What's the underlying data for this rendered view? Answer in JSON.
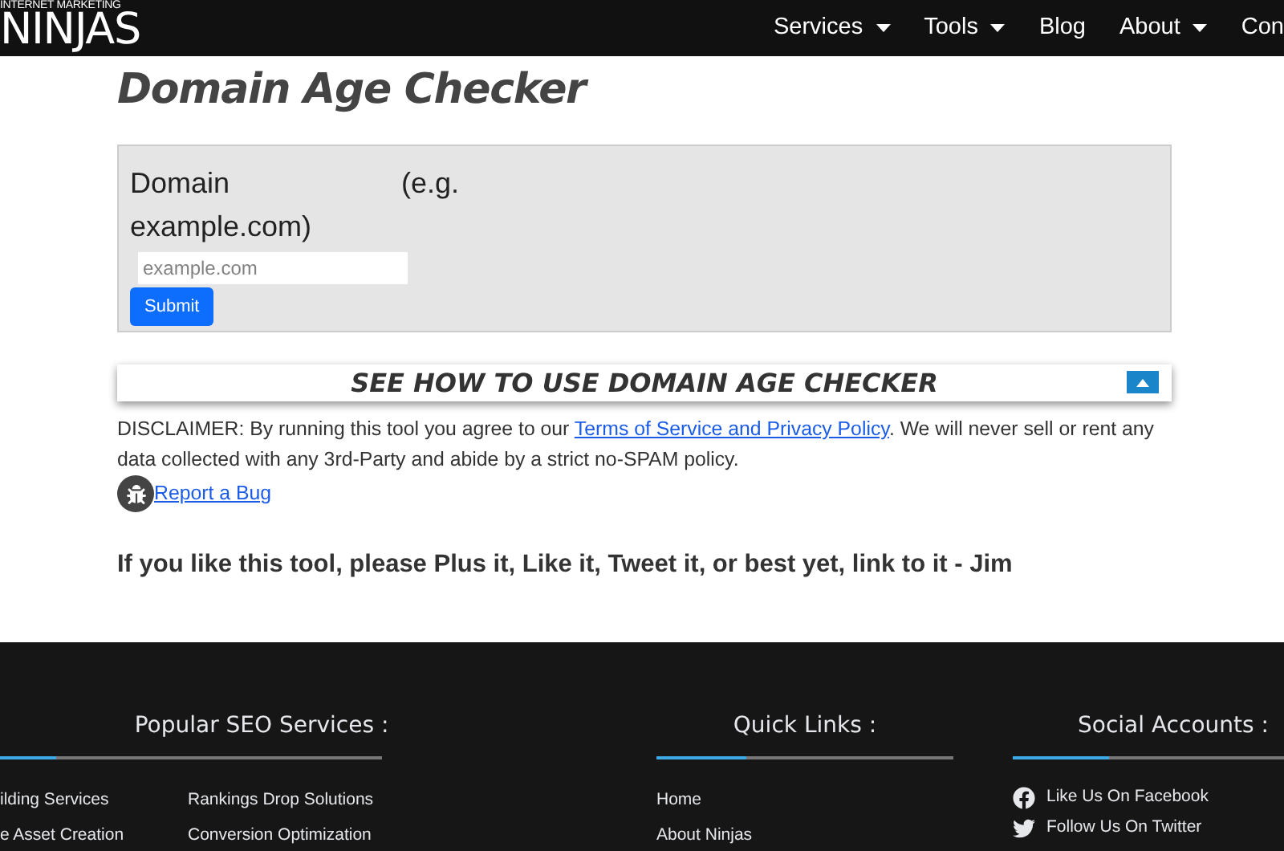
{
  "header": {
    "logo_top": "INTERNET MARKETING",
    "logo_main": "NINJAS",
    "nav": [
      {
        "label": "Services",
        "dropdown": true
      },
      {
        "label": "Tools",
        "dropdown": true
      },
      {
        "label": "Blog",
        "dropdown": false
      },
      {
        "label": "About",
        "dropdown": true
      },
      {
        "label": "Con",
        "dropdown": false
      }
    ]
  },
  "title": "Domain Age Checker",
  "form": {
    "label": "Domain (e.g. example.com)",
    "placeholder": "example.com",
    "button": "Submit"
  },
  "howto": {
    "title": "SEE HOW TO USE DOMAIN AGE CHECKER",
    "expanded": true
  },
  "disclaimer": {
    "before": "DISCLAIMER: By running this tool you agree to our ",
    "link": "Terms of Service and Privacy Policy",
    "after": ". We will never sell or rent any data collected with any 3rd-Party and abide by a strict no-SPAM policy."
  },
  "report_bug": "Report a Bug",
  "cta": "If you like this tool, please Plus it, Like it, Tweet it, or best yet, link to it - Jim",
  "footer": {
    "seo": {
      "heading": "Popular SEO Services :",
      "col_1": [
        "ilding Services",
        "e Asset Creation"
      ],
      "col_2": [
        "Rankings Drop Solutions",
        "Conversion Optimization"
      ]
    },
    "quick": {
      "heading": "Quick Links :",
      "links": [
        "Home",
        "About Ninjas"
      ]
    },
    "social": {
      "heading": "Social Accounts :",
      "links": [
        {
          "kind": "facebook",
          "label": "Like Us On Facebook"
        },
        {
          "kind": "twitter",
          "label": "Follow Us On Twitter"
        }
      ]
    }
  }
}
